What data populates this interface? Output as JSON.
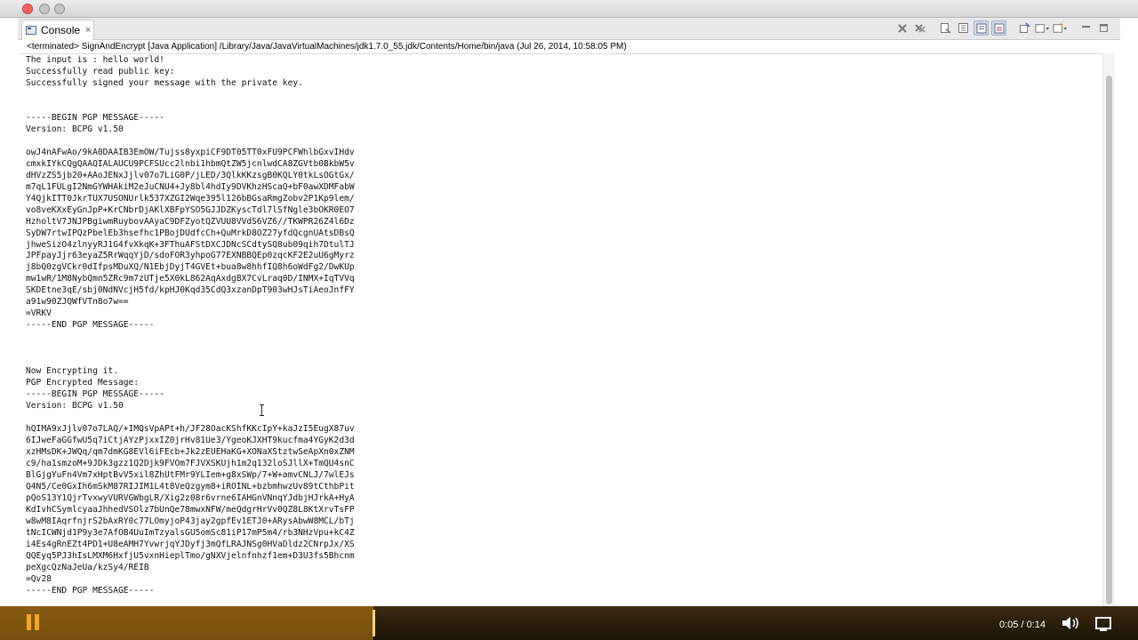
{
  "window": {
    "colors": {
      "close": "#fc605c",
      "inactive": "#c7c7c7"
    }
  },
  "view": {
    "tab_label": "Console",
    "close_glyph": "×",
    "toolbar_icons": [
      "terminate-icon",
      "remove-launch-icon",
      "remove-all-icon",
      "clear-console-icon",
      "scroll-lock-icon",
      "show-on-output-icon",
      "show-on-error-icon",
      "pin-console-icon",
      "display-selected-console-icon",
      "open-console-icon",
      "minimize-icon",
      "maximize-icon"
    ]
  },
  "console": {
    "status": "<terminated> SignAndEncrypt [Java Application] /Library/Java/JavaVirtualMachines/jdk1.7.0_55.jdk/Contents/Home/bin/java (Jul 26, 2014, 10:58:05 PM)",
    "lines": [
      "The input is : hello world!",
      "Successfully read public key:",
      "Successfully signed your message with the private key.",
      "",
      "",
      "-----BEGIN PGP MESSAGE-----",
      "Version: BCPG v1.50",
      "",
      "owJ4nAFwAo/9kA0DAAIB3EmOW/Tujss8yxpiCF9DT05TT0xFU9PCFWhlbGxvIHdv",
      "cmxkIYkCQgQAAQIALAUCU9PCFSUcc2lnbi1hbmQtZW5jcnlwdCA8ZGVtb0BkbW5v",
      "dHVzZS5jb20+AAoJENxJjlv07o7LiG0P/jLED/3QlkKKzsgB0KQLY0tkLsOGtGx/",
      "m7qL1FULgI2NmGYWHAkiM2eJuCNU4+Jy8bl4hdIy9DVKhzHScaQ+bF0awXDMFabW",
      "Y4QjkITT0JkrTUX7USONUrlk537XZGI2Wqe395l126bBGsaRmgZobv2P1Kp9lem/",
      "vo8veKXxEyGnJpP+KrCNbrDjAKlXBFpYSO5GJJDZKyscTdl7lSfNgle3bOKR0EO7",
      "HzholtV7JNJPBgiwmRuybovAAyaC9DFZyotQZVUU8VVdS6VZ6//TKWPR26Z4l6Dz",
      "SyDW7rtwIPQzPbelEb3hsefhc1PBojDUdfcCh+QuMrkD8OZ27yfdQcgnUAtsDBsQ",
      "jhweSizO4zlnyyRJ1G4fvXkqK+3FThuAFStDXCJDNcSCdtySQ8ub09qih7DtulTJ",
      "JPFpayJjr63eyaZ5RrWqqYjD/sdoFOR3yhpoG77EXNBBQEp0zqcKF2E2uU6gMyrz",
      "j8bQ0zgVCkr0dIfpsMDuXQ/N1EbjDyjT4GVEt+bua8w8hhfIQ8h6oWdFg2/DwKUp",
      "mw1wR/1M8NybQmn5ZRc9m7zUTje5X0kL862AqAxdgBX7CvLraq0D/INMX+IqTVVq",
      "SKDEtne3qE/sbj0NdNVcjH5fd/kpHJ0Kqd35CdQ3xzanDpT903wHJsTiAeoJnfFY",
      "a91w90ZJQWfVTn8o7w==",
      "=VRKV",
      "-----END PGP MESSAGE-----",
      "",
      "",
      "",
      "Now Encrypting it.",
      "PGP Encrypted Message:",
      "-----BEGIN PGP MESSAGE-----",
      "Version: BCPG v1.50",
      "",
      "hQIMA9xJjlv07o7LAQ/+IMQsVpAPt+h/JF28OacKShfKKcIpY+kaJzI5EugX87uv",
      "6IJweFaGGfwU5q7iCtjAYzPjxxIZ0jrHv81Ue3/YgeoKJXHT9kucfma4YGyK2d3d",
      "xzHMsDK+JWQq/qm7dmKG8EVl6iFEcb+Jk2zEUEHaKG+XONaXStztwSeApXn0xZNM",
      "c9/ha1smzoM+9JDk3gzz1Q2Djk9FVOm7FJVXSKUjh1m2q132loSJllX+TmQU4snC",
      "BlGjgYuFn4Vm7xHptBvV5xil8ZhUtFMr9YLIem+g8xSWp/7+W+amvCNLJ/7wlEJs",
      "Q4N5/Ce0GxIh6mSkM87RIJIM1L4t8VeQzgym8+iROINL+bzbmhwzUv89tCthbPit",
      "pQoS13Y1QjrTvxwyVURVGWbgLR/Xig2z08r6vrne6IAHGnVNnqYJdbjHJrkA+HyA",
      "KdIvhCSymlcyaaJhhedVSOlz7bUnQe78mwxNFW/meQdgrHrVv0QZ8L8KtXrvTsFP",
      "w8wM8IAqrfnjrS2bAxRY0c77LOmyjoP43jay2gpfEv1ETJ0+ARysAbwW8MCL/bTj",
      "tNcICWNjd1P9y3e7AfOB4UuImTzyalsGU5omSc81iP17mP5m4/rb3NHzVpu+kC4Z",
      "i4Es4gRnEZt4PD1+U8eAMH7YvwrjqYJDyfj3mQfLRAJNSg0HVaDldz2CNrpJx/XS",
      "QQEyq5PJ3hIsLMXM6HxfjU5vxnHieplTmo/gNXVjelnfnhzf1em+D3U3fs5Bhcnm",
      "peXgcQzNaJeUa/kzSy4/REIB",
      "=Qv28",
      "-----END PGP MESSAGE-----"
    ]
  },
  "player": {
    "time": "0:05 / 0:14",
    "progress": 0.357,
    "accent": "#f2a51e"
  }
}
